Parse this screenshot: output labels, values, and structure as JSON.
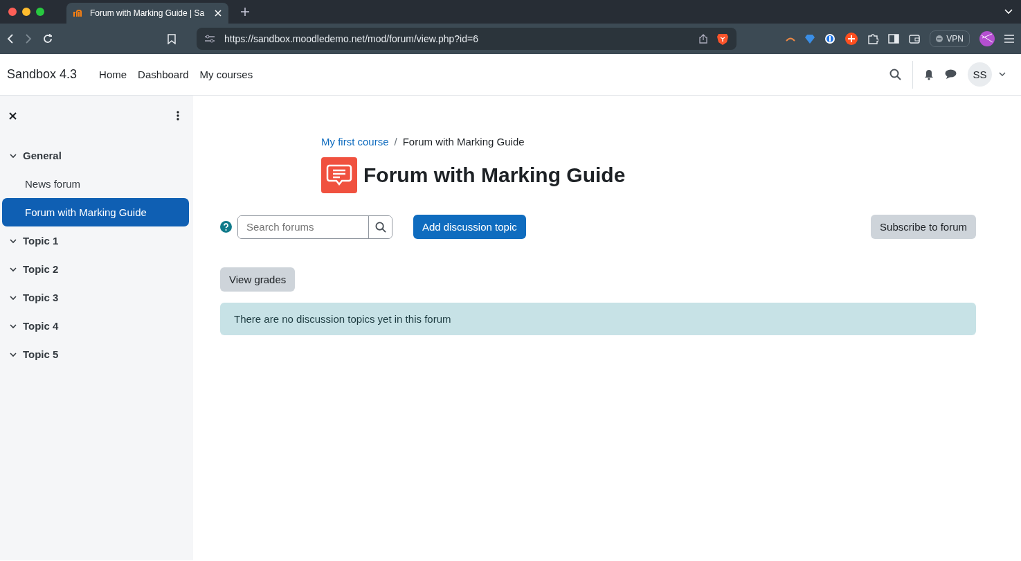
{
  "browser": {
    "tabs": [
      {
        "title": "Forum with Marking Guide | Sa",
        "selected": true
      }
    ],
    "url": "https://sandbox.moodledemo.net/mod/forum/view.php?id=6",
    "vpn_label": "VPN"
  },
  "navbar": {
    "brand": "Sandbox 4.3",
    "links": [
      {
        "label": "Home",
        "selected": false
      },
      {
        "label": "Dashboard",
        "selected": false
      },
      {
        "label": "My courses",
        "selected": false
      }
    ],
    "user_initials": "SS"
  },
  "sidebar": {
    "sections": [
      {
        "label": "General",
        "expanded": true,
        "children": [
          {
            "label": "News forum",
            "selected": false
          },
          {
            "label": "Forum with Marking Guide",
            "selected": true
          }
        ]
      },
      {
        "label": "Topic 1",
        "expanded": true
      },
      {
        "label": "Topic 2",
        "expanded": true
      },
      {
        "label": "Topic 3",
        "expanded": true
      },
      {
        "label": "Topic 4",
        "expanded": true
      },
      {
        "label": "Topic 5",
        "expanded": true
      }
    ]
  },
  "breadcrumb": [
    {
      "label": "My first course",
      "link": true
    },
    {
      "label": "Forum with Marking Guide",
      "link": false
    }
  ],
  "breadcrumb_separator": "/",
  "page_title": "Forum with Marking Guide",
  "search": {
    "placeholder": "Search forums"
  },
  "buttons": {
    "add": "Add discussion topic",
    "subscribe": "Subscribe to forum",
    "grades": "View grades"
  },
  "notice": "There are no discussion topics yet in this forum"
}
